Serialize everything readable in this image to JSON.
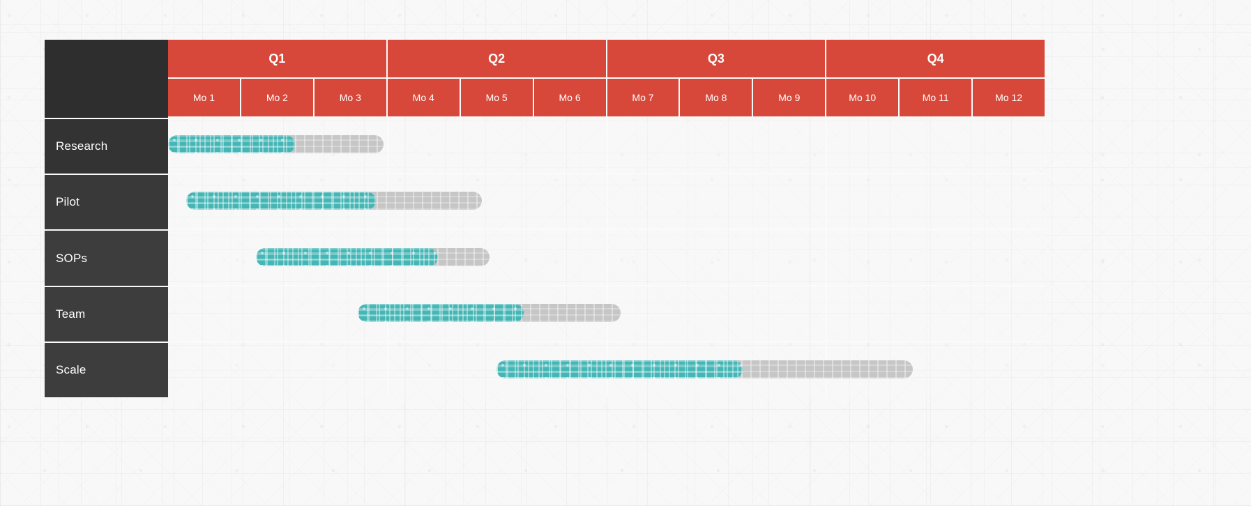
{
  "chart_data": {
    "type": "bar",
    "title": "",
    "subtitle": "",
    "xlabel": "",
    "ylabel": "",
    "chart_kind": "gantt",
    "total_months": 12,
    "quarters": [
      "Q1",
      "Q2",
      "Q3",
      "Q4"
    ],
    "months": [
      "Mo 1",
      "Mo 2",
      "Mo 3",
      "Mo 4",
      "Mo 5",
      "Mo 6",
      "Mo 7",
      "Mo 8",
      "Mo 9",
      "Mo 10",
      "Mo 11",
      "Mo 12"
    ],
    "categories": [
      "Research",
      "Pilot",
      "SOPs",
      "Team",
      "Scale"
    ],
    "tasks": [
      {
        "label": "Research",
        "start_month": 1.0,
        "end_month": 2.95,
        "progress_pct": 59
      },
      {
        "label": "Pilot",
        "start_month": 1.25,
        "end_month": 4.3,
        "progress_pct": 64
      },
      {
        "label": "SOPs",
        "start_month": 2.2,
        "end_month": 4.4,
        "progress_pct": 78
      },
      {
        "label": "Team",
        "start_month": 3.6,
        "end_month": 6.2,
        "progress_pct": 63
      },
      {
        "label": "Scale",
        "start_month": 5.5,
        "end_month": 10.2,
        "progress_pct": 59
      }
    ],
    "legend": [],
    "grid": true,
    "colors": {
      "header": "#d8483a",
      "sidebar": "#3d3d3d",
      "progress": "#45b6b6",
      "remaining": "#c6c6c6",
      "grid_line": "#fbfbfb",
      "background": "#f8f8f8",
      "header_text": "#ffffff",
      "sidebar_text": "#ffffff"
    }
  }
}
